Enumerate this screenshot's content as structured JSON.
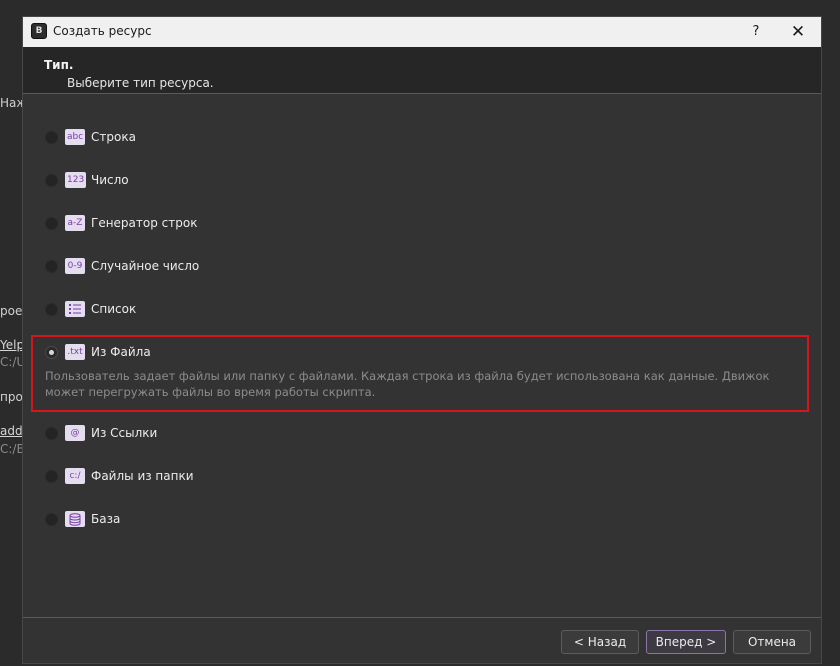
{
  "background": {
    "fragments": [
      "Наж",
      "рое",
      "Yelp",
      "C:/U",
      "про",
      "add-",
      "C:/Ba"
    ]
  },
  "dialog": {
    "app_icon": "В",
    "title": "Создать ресурс",
    "help": "?",
    "close": "✕",
    "header": {
      "title": "Тип.",
      "subtitle": "Выберите тип ресурса."
    },
    "options": [
      {
        "icon": "abc",
        "label": "Строка",
        "checked": false
      },
      {
        "icon": "123",
        "label": "Число",
        "checked": false
      },
      {
        "icon": "a-Z",
        "label": "Генератор строк",
        "checked": false
      },
      {
        "icon": "0-9",
        "label": "Случайное число",
        "checked": false
      },
      {
        "icon": "list-icon",
        "label": "Список",
        "checked": false
      },
      {
        "icon": ".txt",
        "label": "Из Файла",
        "checked": true,
        "description": "Пользователь задает файлы или папку с файлами. Каждая строка из файла будет использована как данные. Движок может перегружать файлы во время работы скрипта."
      },
      {
        "icon": "@",
        "label": "Из Ссылки",
        "checked": false
      },
      {
        "icon": "c:/",
        "label": "Файлы из папки",
        "checked": false
      },
      {
        "icon": "database-icon",
        "label": "База",
        "checked": false
      }
    ],
    "buttons": {
      "back": "< Назад",
      "next": "Вперед >",
      "cancel": "Отмена"
    },
    "colors": {
      "highlight": "#d6151b",
      "icon_bg": "#e4dcef",
      "icon_fg": "#7a3ea8"
    }
  }
}
